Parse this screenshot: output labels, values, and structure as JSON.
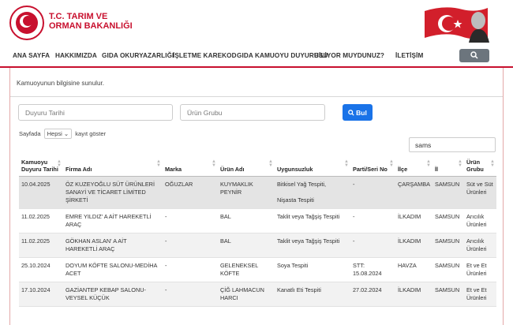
{
  "header": {
    "brand_line1": "T.C. TARIM VE",
    "brand_line2": "ORMAN BAKANLIĞI"
  },
  "nav": [
    "ANA SAYFA",
    "HAKKIMIZDA",
    "GIDA OKURYAZARLIĞI",
    "İŞLETME KAREKOD",
    "GIDA KAMUOYU DUYURUSU",
    "BİLİYOR MUYDUNUZ?",
    "İLETİŞİM"
  ],
  "intro": "Kamuoyunun bilgisine sunulur.",
  "filters": {
    "date_placeholder": "Duyuru Tarihi",
    "group_placeholder": "Ürün Grubu",
    "search_label": "Bul"
  },
  "per_page": {
    "prefix": "Sayfada",
    "value": "Hepsi",
    "suffix": "kayıt göster"
  },
  "table_filter": "sams",
  "columns": [
    "Kamuoyu Duyuru Tarihi",
    "Firma Adı",
    "Marka",
    "Ürün Adı",
    "Uygunsuzluk",
    "Parti/Seri No",
    "İlçe",
    "İl",
    "Ürün Grubu"
  ],
  "rows": [
    [
      "10.04.2025",
      "ÖZ KUZEYOĞLU SÜT ÜRÜNLERİ SANAYİ VE TİCARET LİMİTED ŞİRKETİ",
      "OĞUZLAR",
      "KUYMAKLIK PEYNİR",
      "Bitkisel Yağ Tespiti,\n\nNişasta Tespiti",
      "-",
      "ÇARŞAMBA",
      "SAMSUN",
      "Süt ve Süt Ürünleri"
    ],
    [
      "11.02.2025",
      "EMRE YILDIZ' A AİT HAREKETLİ ARAÇ",
      "-",
      "BAL",
      "Taklit veya Tağşiş Tespiti",
      "-",
      "İLKADIM",
      "SAMSUN",
      "Arıcılık Ürünleri"
    ],
    [
      "11.02.2025",
      "GÖKHAN ASLAN' A AİT HAREKETLİ ARAÇ",
      "-",
      "BAL",
      "Taklit veya Tağşiş Tespiti",
      "-",
      "İLKADIM",
      "SAMSUN",
      "Arıcılık Ürünleri"
    ],
    [
      "25.10.2024",
      "DOYUM KÖFTE SALONU-MEDİHA ACET",
      "-",
      "GELENEKSEL KÖFTE",
      "Soya Tespiti",
      "STT: 15.08.2024",
      "HAVZA",
      "SAMSUN",
      "Et ve Et Ürünleri"
    ],
    [
      "17.10.2024",
      "GAZİANTEP KEBAP SALONU-VEYSEL KÜÇÜK",
      "-",
      "ÇİĞ LAHMACUN HARCI",
      "Kanatlı Eti Tespiti",
      "27.02.2024",
      "İLKADIM",
      "SAMSUN",
      "Et ve Et Ürünleri"
    ]
  ]
}
